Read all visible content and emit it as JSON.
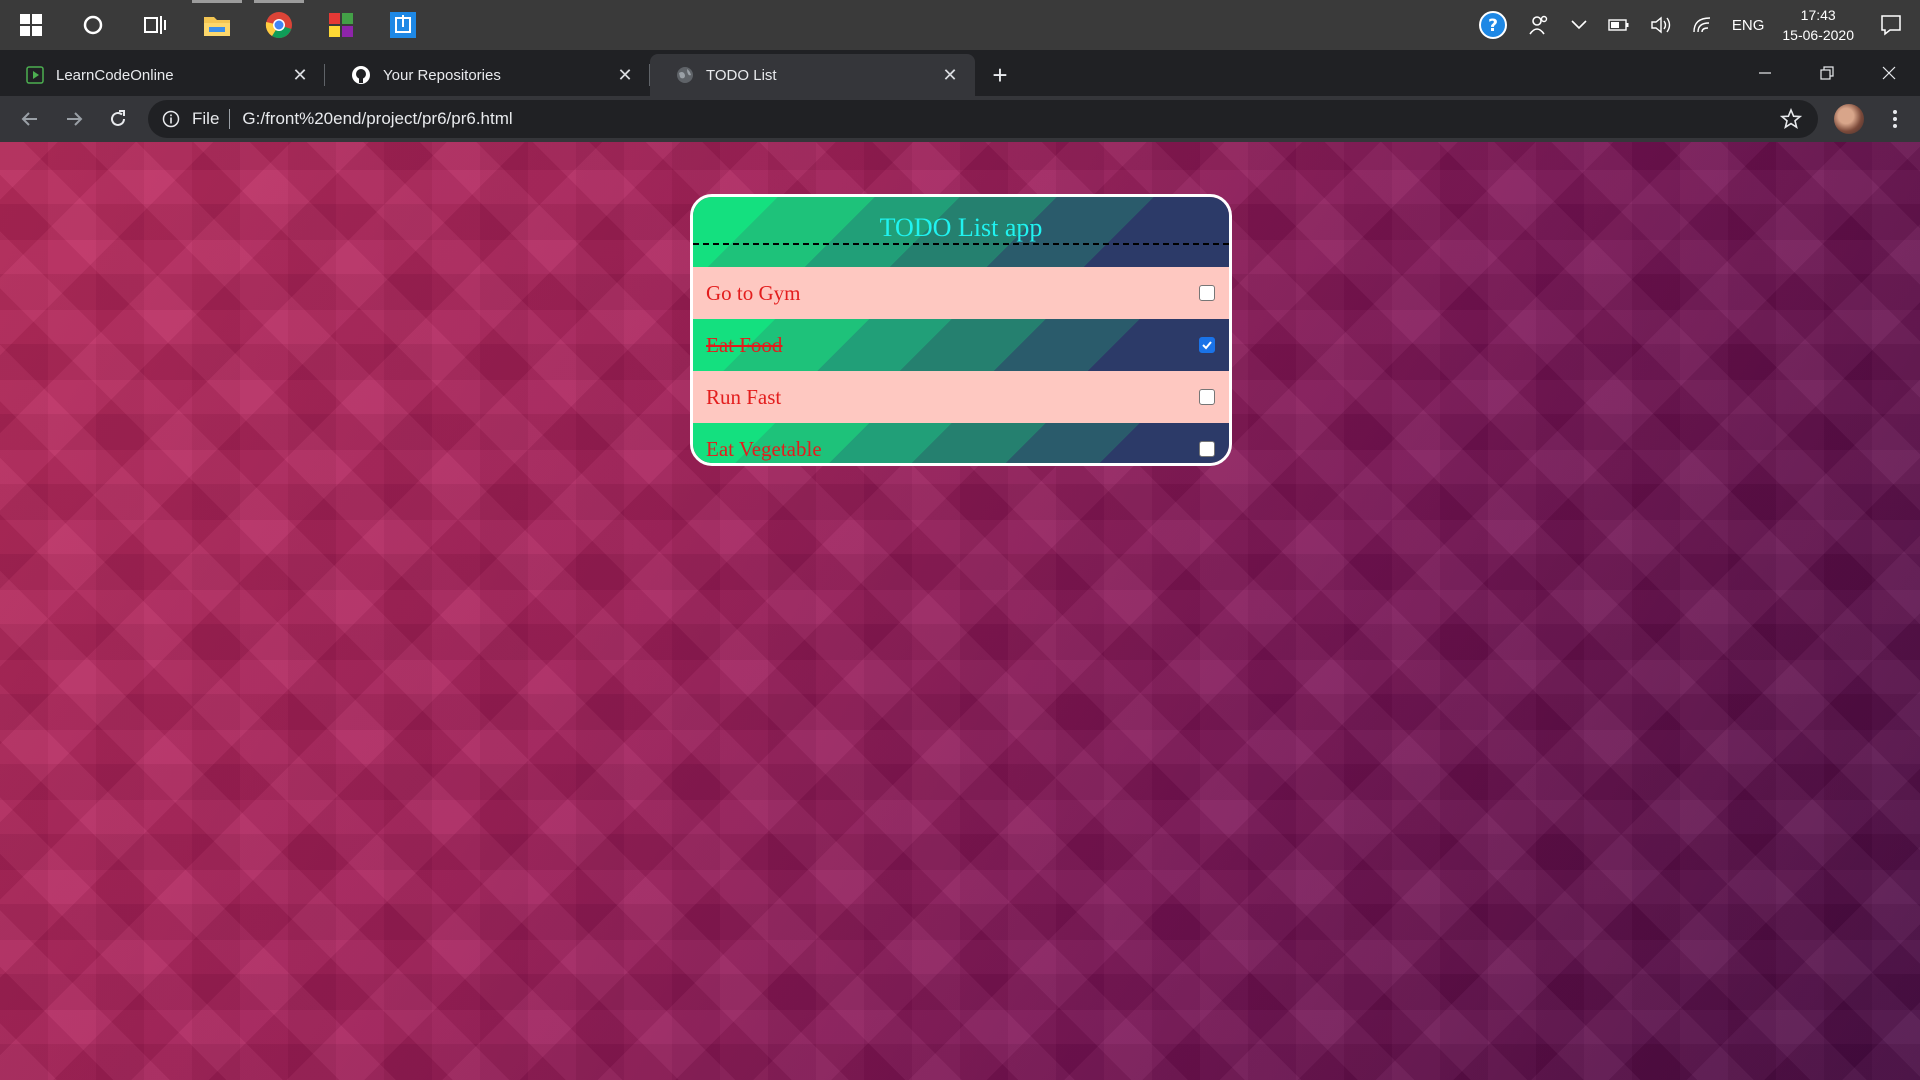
{
  "taskbar": {
    "apps": [
      {
        "name": "start",
        "icon": "windows-logo-icon"
      },
      {
        "name": "search",
        "icon": "cortana-circle-icon"
      },
      {
        "name": "task-view",
        "icon": "task-view-icon"
      },
      {
        "name": "file-explorer",
        "icon": "folder-icon"
      },
      {
        "name": "chrome",
        "icon": "chrome-icon"
      },
      {
        "name": "store",
        "icon": "colorful-squares-icon"
      },
      {
        "name": "app",
        "icon": "blue-square-app-icon"
      }
    ],
    "language": "ENG",
    "time": "17:43",
    "date": "15-06-2020"
  },
  "browser": {
    "tabs": [
      {
        "title": "LearnCodeOnline",
        "icon": "lco-play-icon",
        "active": false
      },
      {
        "title": "Your Repositories",
        "icon": "github-icon",
        "active": false
      },
      {
        "title": "TODO List",
        "icon": "globe-icon",
        "active": true
      }
    ],
    "new_tab": "+",
    "omnibox": {
      "scheme_label": "File",
      "url": "G:/front%20end/project/pr6/pr6.html"
    }
  },
  "todo": {
    "title": "TODO List app",
    "items": [
      {
        "label": "Go to Gym",
        "checked": false
      },
      {
        "label": "Eat Food",
        "checked": true
      },
      {
        "label": "Run Fast",
        "checked": false
      },
      {
        "label": "Eat Vegetable",
        "checked": false
      }
    ],
    "colors": {
      "title": "#20f3f0",
      "item_text": "#e31d1d",
      "light_row": "#fec8c1"
    }
  }
}
